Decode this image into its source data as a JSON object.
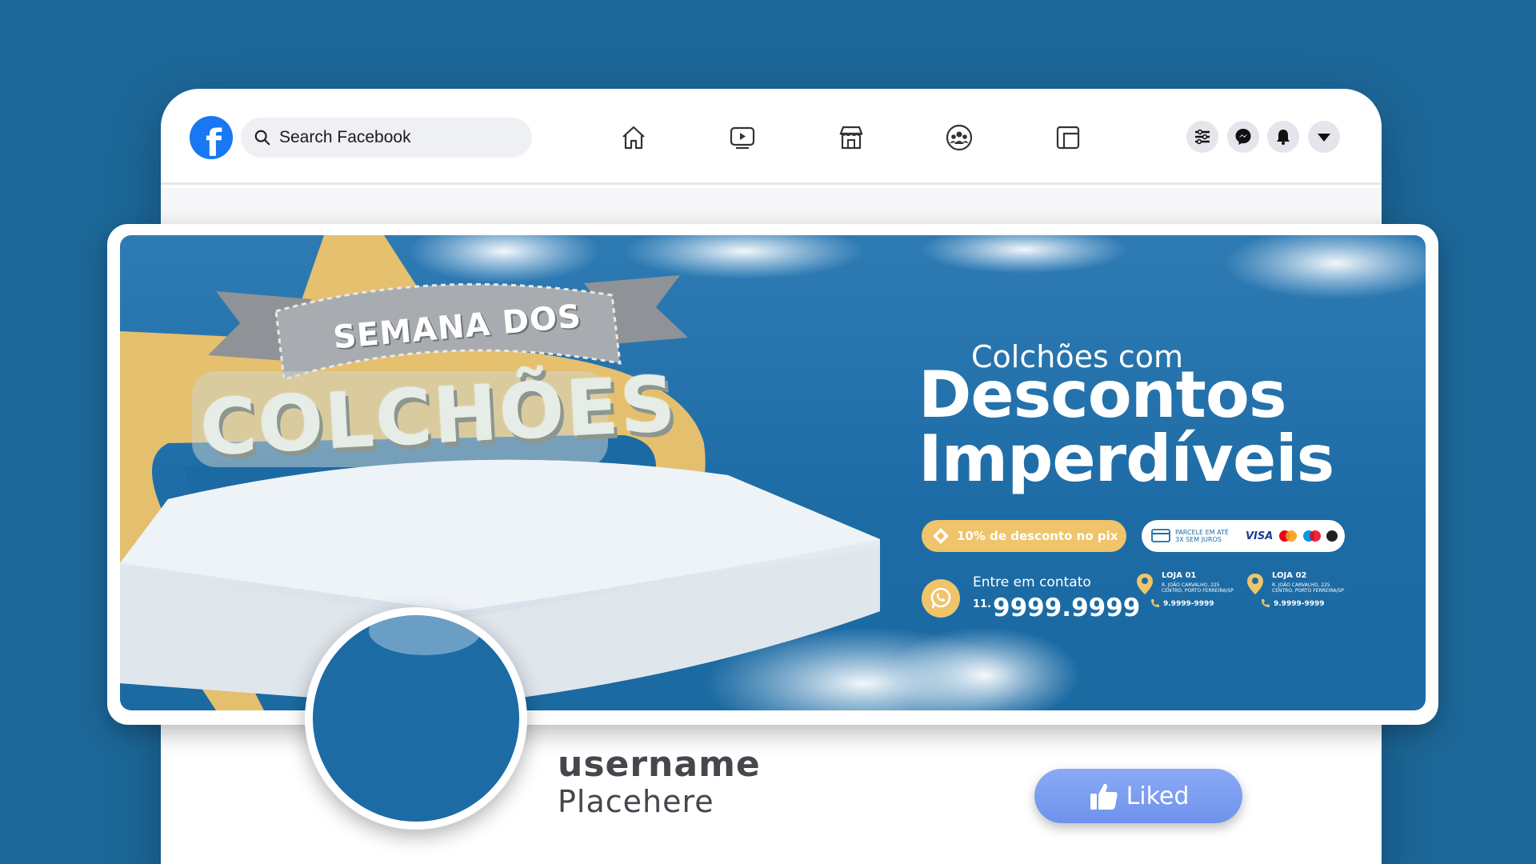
{
  "header": {
    "logo": "facebook-logo",
    "search_placeholder": "Search Facebook",
    "nav_icons": [
      "home-icon",
      "watch-icon",
      "marketplace-icon",
      "groups-icon",
      "gaming-icon"
    ],
    "action_icons": [
      "menu-icon",
      "messenger-icon",
      "notifications-icon",
      "account-dropdown-icon"
    ]
  },
  "cover": {
    "ribbon_text": "SEMANA DOS",
    "title_3d": "COLCHÕES",
    "headline_small": "Colchões com",
    "headline_line1": "Descontos",
    "headline_line2": "Imperdíveis",
    "pix_badge": "10% de desconto no pix",
    "installments": "PARCELE EM ATÉ 3X SEM JUROS",
    "card_brand": "VISA",
    "contact_label": "Entre em contato",
    "contact_ddd": "11.",
    "contact_phone": "9999.9999",
    "stores": [
      {
        "name": "LOJA 01",
        "address": "R. JOÃO CARVALHO, 225 CENTRO, PORTO FERREIRA/SP",
        "phone": "9.9999-9999"
      },
      {
        "name": "LOJA 02",
        "address": "R. JOÃO CARVALHO, 225 CENTRO, PORTO FERREIRA/SP",
        "phone": "9.9999-9999"
      }
    ],
    "colors": {
      "blue": "#1d6ba5",
      "gold": "#efc46a",
      "white": "#ffffff"
    }
  },
  "profile": {
    "username": "username",
    "subtitle": "Placehere",
    "like_button": "Liked"
  }
}
